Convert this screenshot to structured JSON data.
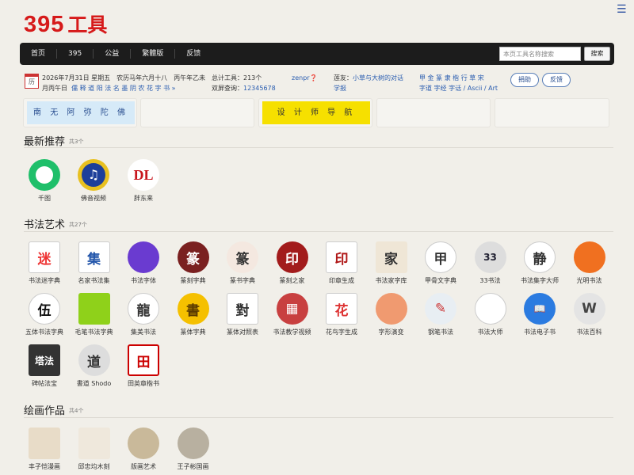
{
  "header": {
    "logo_num": "395",
    "logo_cn": "工具",
    "menu_icon": "☰"
  },
  "nav": {
    "items": [
      "首页",
      "395",
      "公益",
      "繁體版",
      "反馈"
    ],
    "search_placeholder": "本页工具名称搜索",
    "search_button": "搜索"
  },
  "info": {
    "cal_icon_text": "历",
    "date_line": "2026年7月31日 星期五　农历马年六月十八　丙午年乙未",
    "day_line_prefix": "月丙午日",
    "day_links": "儒 释 道 阳 法 名 墨 阴 农 花 字 书 »",
    "total_tools": "总计工具：213个",
    "query": "双屏查询：",
    "query_num": "12345678",
    "user": "zenpr❓",
    "friend_label": "莲友：",
    "friend_link": "小草与大树的对话",
    "study": "学报",
    "fonts_line1": "甲 金 篆 隶 楷 行 草 宋",
    "fonts_line2": "字道 字经 字话 / Ascii / Art",
    "donate_button": "捐助",
    "feedback_button": "反馈"
  },
  "banners": {
    "left": "南 无 阿 弥 陀 佛",
    "mid": "设 计 师 导 航"
  },
  "sections": {
    "recommend": {
      "title": "最新推荐",
      "count": "共3个",
      "items": [
        "千图",
        "佛音视频",
        "胖东来"
      ]
    },
    "calligraphy": {
      "title": "书法艺术",
      "count": "共27个",
      "items": [
        "书法迷字典",
        "名家书法集",
        "书法字体",
        "篆刻字典",
        "篆书字典",
        "篆刻之家",
        "印章生成",
        "书法家字库",
        "甲骨文字典",
        "33书法",
        "书法集字大师",
        "光明书法",
        "五体书法字典",
        "毛笔书法字典",
        "集美书法",
        "篆体字典",
        "篆体对照表",
        "书法教学视频",
        "花鸟字生成",
        "字形演变",
        "钢笔书法",
        "书法大师",
        "书法电子书",
        "书法百科",
        "碑帖法宝",
        "書道 Shodo",
        "田英章楷书"
      ]
    },
    "painting": {
      "title": "绘画作品",
      "count": "共4个",
      "items": [
        "丰子恺漫画",
        "邱忠均木刻",
        "版画艺术",
        "王子彬国画"
      ]
    }
  },
  "icon_glyphs": {
    "qiantu": "",
    "foyin": "♫",
    "pangdonglai": "DL",
    "c1": "迷",
    "c2": "集",
    "c3": "",
    "c4": "篆",
    "c5": "篆",
    "c6": "印",
    "c7": "印",
    "c8": "家",
    "c9": "甲",
    "c10": "33",
    "c11": "静",
    "c12": "",
    "c13": "伍",
    "c14": "",
    "c15": "龍",
    "c16": "書",
    "c17": "對",
    "c18": "▦",
    "c19": "花",
    "c20": "",
    "c21": "✎",
    "c22": "",
    "c23": "📖",
    "c24": "W",
    "c25": "塔法",
    "c26": "道",
    "c27": "田"
  },
  "colors": {
    "brand": "#d61a1a",
    "nav_bg": "#1c1c1c",
    "banner_yellow": "#f6e000",
    "banner_blue": "#d6eaf8"
  }
}
